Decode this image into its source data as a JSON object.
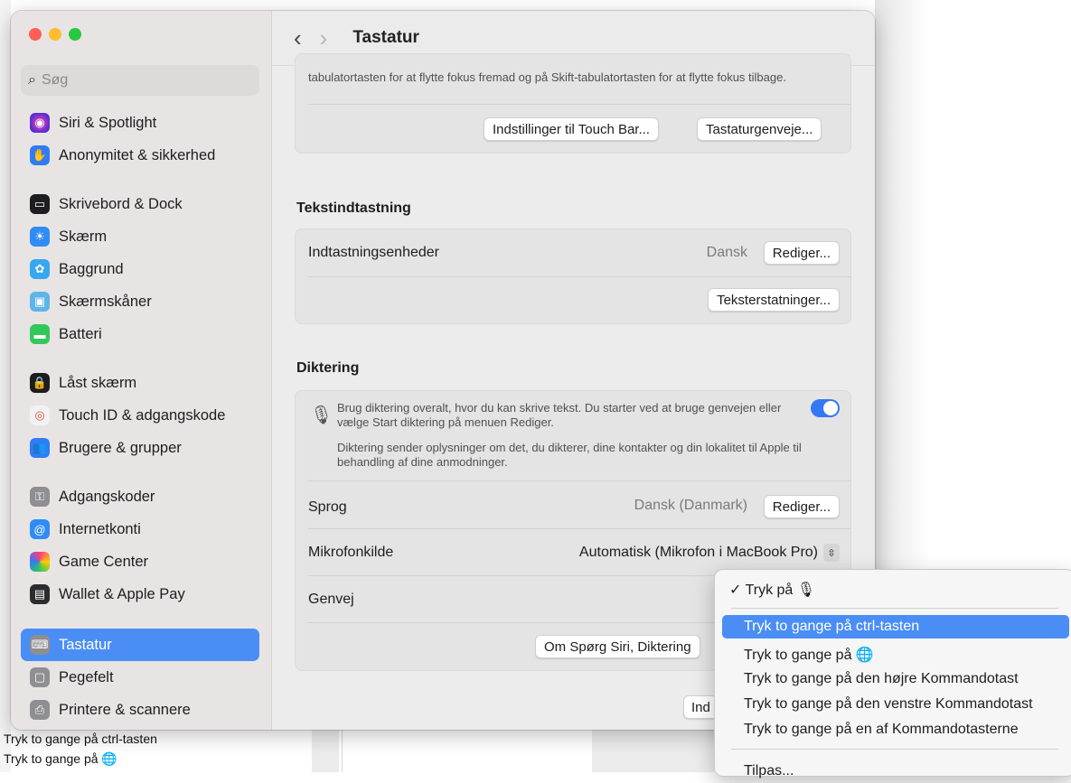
{
  "background": {
    "items": [
      "Tryk to gange på ctrl-tasten",
      "Tryk to gange på 🌐"
    ]
  },
  "window": {
    "title": "Tastatur",
    "search_placeholder": "Søg"
  },
  "sidebar": {
    "items": [
      {
        "label": "Siri & Spotlight",
        "icon": "siri-icon",
        "color": "#7a3fd6"
      },
      {
        "label": "Anonymitet & sikkerhed",
        "icon": "hand-icon",
        "color": "#2f7cf6"
      },
      {
        "label": "Skrivebord & Dock",
        "icon": "dock-icon",
        "color": "#1d1d1f"
      },
      {
        "label": "Skærm",
        "icon": "sun-icon",
        "color": "#2f8cf6"
      },
      {
        "label": "Baggrund",
        "icon": "flower-icon",
        "color": "#38a6f0"
      },
      {
        "label": "Skærmskåner",
        "icon": "screensaver-icon",
        "color": "#5fb4e8"
      },
      {
        "label": "Batteri",
        "icon": "battery-icon",
        "color": "#34c759"
      },
      {
        "label": "Låst skærm",
        "icon": "lock-icon",
        "color": "#1d1d1f"
      },
      {
        "label": "Touch ID & adgangskode",
        "icon": "fingerprint-icon",
        "color": "#f2f2f2"
      },
      {
        "label": "Brugere & grupper",
        "icon": "users-icon",
        "color": "#2f7cf6"
      },
      {
        "label": "Adgangskoder",
        "icon": "key-icon",
        "color": "#8e8e93"
      },
      {
        "label": "Internetkonti",
        "icon": "at-icon",
        "color": "#2f8cf6"
      },
      {
        "label": "Game Center",
        "icon": "gamecenter-icon",
        "color": "#f0f0f0"
      },
      {
        "label": "Wallet & Apple Pay",
        "icon": "wallet-icon",
        "color": "#2c2c2e"
      },
      {
        "label": "Tastatur",
        "icon": "keyboard-icon",
        "color": "#8e8e93"
      },
      {
        "label": "Pegefelt",
        "icon": "trackpad-icon",
        "color": "#8e8e93"
      },
      {
        "label": "Printere & scannere",
        "icon": "printer-icon",
        "color": "#8e8e93"
      }
    ]
  },
  "top_card": {
    "text": "tabulatortasten for at flytte fokus fremad og på Skift-tabulatortasten for at flytte fokus tilbage.",
    "btn_touchbar": "Indstillinger til Touch Bar...",
    "btn_shortcuts": "Tastaturgenveje..."
  },
  "text_input": {
    "heading": "Tekstindtastning",
    "row_label": "Indtastningsenheder",
    "row_value": "Dansk",
    "edit_btn": "Rediger...",
    "replace_btn": "Teksterstatninger..."
  },
  "dictation": {
    "heading": "Diktering",
    "desc1": "Brug diktering overalt, hvor du kan skrive tekst. Du starter ved at bruge genvejen eller vælge Start diktering på menuen Rediger.",
    "desc2": "Diktering sender oplysninger om det, du dikterer, dine kontakter og din lokalitet til Apple til behandling af dine anmodninger.",
    "enabled": true,
    "lang_label": "Sprog",
    "lang_value": "Dansk (Danmark)",
    "lang_btn": "Rediger...",
    "mic_label": "Mikrofonkilde",
    "mic_value": "Automatisk (Mikrofon i MacBook Pro)",
    "shortcut_label": "Genvej",
    "about_btn": "Om Spørg Siri, Diktering",
    "partial_btn": "Ind"
  },
  "menu": {
    "checked_item": "✓ Tryk på 🎙",
    "items": [
      "Tryk to gange på ctrl-tasten",
      "Tryk to gange på 🌐",
      "Tryk to gange på den højre Kommandotast",
      "Tryk to gange på den venstre Kommandotast",
      "Tryk to gange på en af Kommandotasterne"
    ],
    "customize": "Tilpas..."
  }
}
